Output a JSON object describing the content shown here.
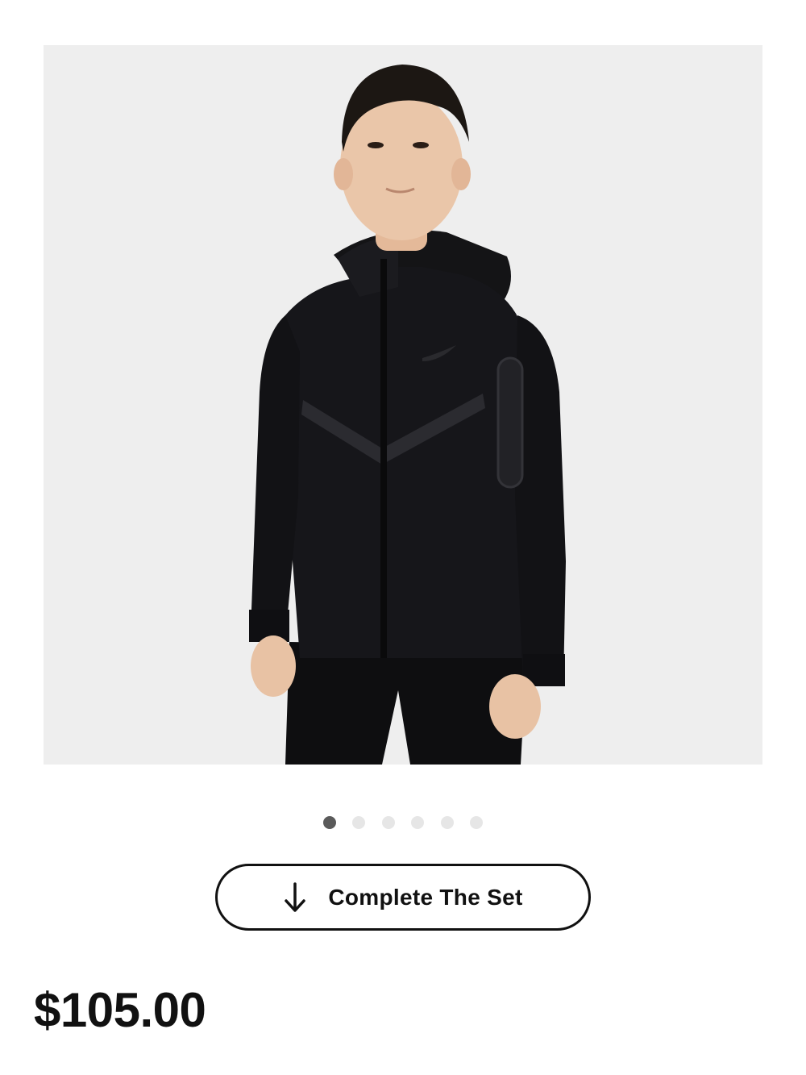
{
  "product": {
    "image": {
      "subject": "kid-black-zip-hoodie",
      "background_color": "#eeeeee"
    },
    "carousel": {
      "total": 6,
      "active_index": 0
    },
    "complete_set_button": {
      "label": "Complete The Set",
      "icon": "arrow-down-icon"
    },
    "price": "$105.00"
  },
  "colors": {
    "accent": "#111111",
    "dot_active": "#5a5a5a",
    "dot_inactive": "#e6e6e6"
  }
}
